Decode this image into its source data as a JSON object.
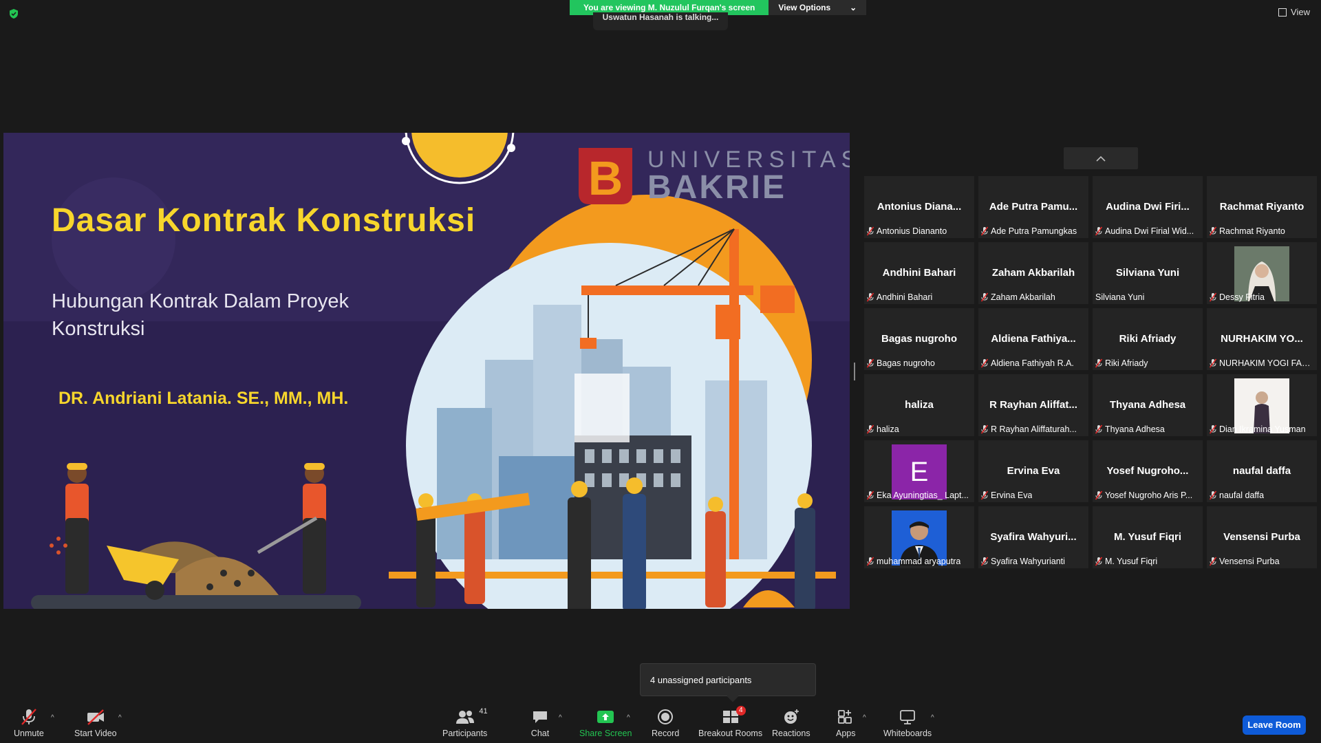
{
  "top": {
    "viewing_banner": "You are viewing M. Nuzulul Furqan's screen",
    "view_options": "View Options",
    "talking": "Uswatun Hasanah is talking...",
    "view": "View"
  },
  "slide": {
    "title": "Dasar Kontrak Konstruksi",
    "subtitle": "Hubungan Kontrak Dalam Proyek Konstruksi",
    "author": "DR. Andriani Latania. SE., MM., MH.",
    "logo_universitas": "UNIVERSITAS",
    "logo_bakrie": "BAKRIE",
    "logo_letter": "B",
    "colors": {
      "background": "#2c2150",
      "title": "#f7d62c",
      "sun": "#f39a1e"
    }
  },
  "gallery": [
    {
      "name": "Antonius  Diana...",
      "label": "Antonius Diananto"
    },
    {
      "name": "Ade Putra Pamu...",
      "label": "Ade Putra Pamungkas"
    },
    {
      "name": "Audina  Dwi  Firi...",
      "label": "Audina Dwi Firial Wid..."
    },
    {
      "name": "Rachmat Riyanto",
      "label": "Rachmat Riyanto"
    },
    {
      "name": "Andhini Bahari",
      "label": "Andhini Bahari"
    },
    {
      "name": "Zaham Akbarilah",
      "label": "Zaham Akbarilah"
    },
    {
      "name": "Silviana Yuni",
      "label": "Silviana Yuni",
      "mic": false
    },
    {
      "name": "",
      "label": "Dessy Fitria",
      "photo": "woman-hijab"
    },
    {
      "name": "Bagas nugroho",
      "label": "Bagas nugroho"
    },
    {
      "name": "Aldiena  Fathiya...",
      "label": "Aldiena Fathiyah R.A."
    },
    {
      "name": "Riki Afriady",
      "label": "Riki Afriady"
    },
    {
      "name": "NURHAKIM  YO...",
      "label": "NURHAKIM YOGI FAH..."
    },
    {
      "name": "haliza",
      "label": "haliza"
    },
    {
      "name": "R  Rayhan  Aliffat...",
      "label": "R Rayhan Aliffaturah..."
    },
    {
      "name": "Thyana Adhesa",
      "label": "Thyana Adhesa"
    },
    {
      "name": "",
      "label": "Dian Ikramina Yusman",
      "photo": "woman-standing"
    },
    {
      "name": "",
      "label": "Eka Ayuningtias_ Lapt...",
      "letter": "E"
    },
    {
      "name": "Ervina Eva",
      "label": "Ervina Eva"
    },
    {
      "name": "Yosef  Nugroho...",
      "label": "Yosef Nugroho Aris P..."
    },
    {
      "name": "naufal daffa",
      "label": "naufal daffa"
    },
    {
      "name": "",
      "label": "muhammad aryaputra",
      "photo": "man-suit"
    },
    {
      "name": "Syafira  Wahyuri...",
      "label": "Syafira Wahyurianti"
    },
    {
      "name": "M. Yusuf Fiqri",
      "label": "M. Yusuf Fiqri"
    },
    {
      "name": "Vensensi Purba",
      "label": "Vensensi Purba"
    }
  ],
  "toast": {
    "text": "4 unassigned participants"
  },
  "toolbar": {
    "unmute": "Unmute",
    "start_video": "Start Video",
    "participants": "Participants",
    "participants_count": "41",
    "chat": "Chat",
    "share_screen": "Share Screen",
    "record": "Record",
    "breakout_rooms": "Breakout Rooms",
    "breakout_badge": "4",
    "reactions": "Reactions",
    "apps": "Apps",
    "whiteboards": "Whiteboards",
    "leave": "Leave Room",
    "colors": {
      "share": "#23c552",
      "leave": "#0e5bd8",
      "muted": "#e02828"
    }
  }
}
